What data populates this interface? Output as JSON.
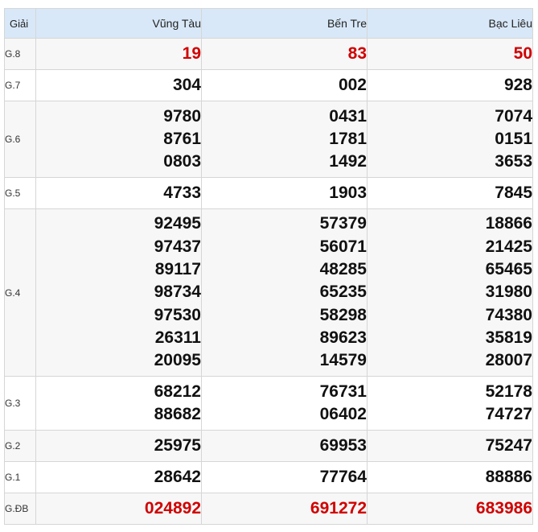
{
  "header": {
    "label": "Giải",
    "provinces": [
      "Vũng Tàu",
      "Bến Tre",
      "Bạc Liêu"
    ]
  },
  "rows": [
    {
      "label": "G.8",
      "values": [
        [
          "19"
        ],
        [
          "83"
        ],
        [
          "50"
        ]
      ],
      "highlight": true
    },
    {
      "label": "G.7",
      "values": [
        [
          "304"
        ],
        [
          "002"
        ],
        [
          "928"
        ]
      ]
    },
    {
      "label": "G.6",
      "values": [
        [
          "9780",
          "8761",
          "0803"
        ],
        [
          "0431",
          "1781",
          "1492"
        ],
        [
          "7074",
          "0151",
          "3653"
        ]
      ]
    },
    {
      "label": "G.5",
      "values": [
        [
          "4733"
        ],
        [
          "1903"
        ],
        [
          "7845"
        ]
      ]
    },
    {
      "label": "G.4",
      "values": [
        [
          "92495",
          "97437",
          "89117",
          "98734",
          "97530",
          "26311",
          "20095"
        ],
        [
          "57379",
          "56071",
          "48285",
          "65235",
          "58298",
          "89623",
          "14579"
        ],
        [
          "18866",
          "21425",
          "65465",
          "31980",
          "74380",
          "35819",
          "28007"
        ]
      ]
    },
    {
      "label": "G.3",
      "values": [
        [
          "68212",
          "88682"
        ],
        [
          "76731",
          "06402"
        ],
        [
          "52178",
          "74727"
        ]
      ]
    },
    {
      "label": "G.2",
      "values": [
        [
          "25975"
        ],
        [
          "69953"
        ],
        [
          "75247"
        ]
      ]
    },
    {
      "label": "G.1",
      "values": [
        [
          "28642"
        ],
        [
          "77764"
        ],
        [
          "88886"
        ]
      ]
    },
    {
      "label": "G.ĐB",
      "values": [
        [
          "024892"
        ],
        [
          "691272"
        ],
        [
          "683986"
        ]
      ],
      "highlight": true
    }
  ],
  "colors": {
    "header_bg": "#d8e8f8",
    "highlight": "#d00000",
    "number": "#111111"
  }
}
